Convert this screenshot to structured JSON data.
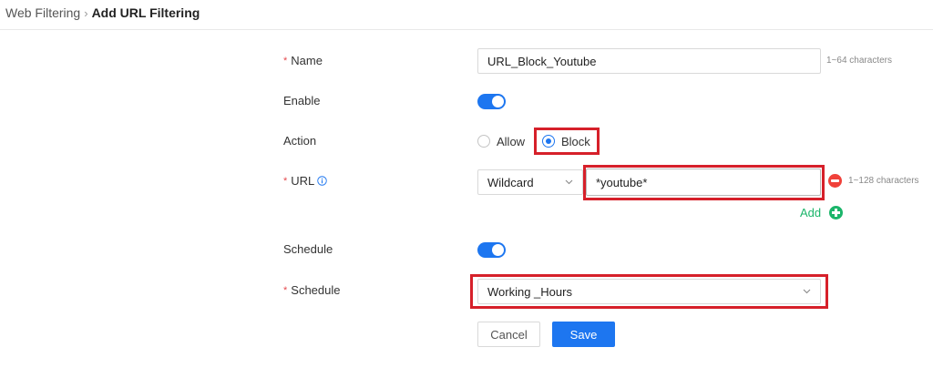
{
  "breadcrumb": {
    "parent": "Web Filtering",
    "separator": "›",
    "current": "Add URL Filtering"
  },
  "form": {
    "name": {
      "required_mark": "*",
      "label": "Name",
      "value": "URL_Block_Youtube",
      "hint": "1~64 characters"
    },
    "enable": {
      "label": "Enable",
      "on": true
    },
    "action": {
      "label": "Action",
      "options": [
        "Allow",
        "Block"
      ],
      "selected": "Block"
    },
    "url": {
      "required_mark": "*",
      "label": "URL",
      "match_type": "Wildcard",
      "value": "*youtube*",
      "hint": "1~128 characters",
      "add_label": "Add"
    },
    "schedule_toggle": {
      "label": "Schedule",
      "on": true
    },
    "schedule": {
      "required_mark": "*",
      "label": "Schedule",
      "value": "Working _Hours"
    }
  },
  "buttons": {
    "cancel": "Cancel",
    "save": "Save"
  },
  "colors": {
    "accent": "#1d76f0",
    "highlight": "#d6202a",
    "remove": "#f0413a",
    "add": "#1bb56a",
    "required": "#e5484d"
  }
}
